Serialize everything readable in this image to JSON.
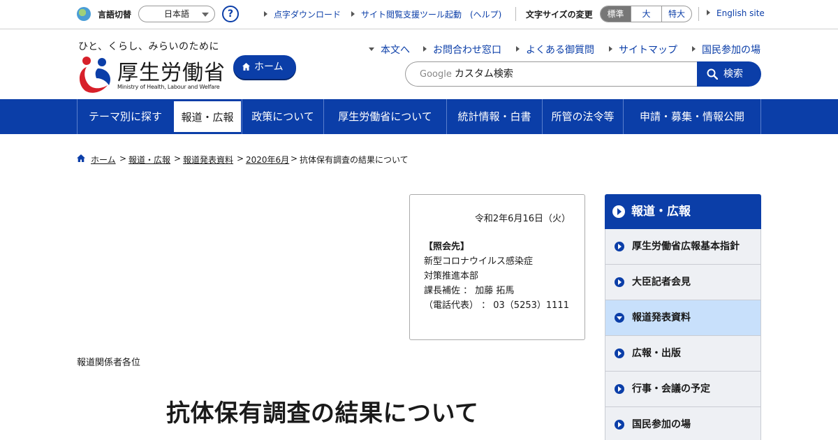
{
  "utility": {
    "language_label": "言語切替",
    "language_value": "日本語",
    "help_label": "?",
    "links": [
      "点字ダウンロード",
      "サイト閲覧支援ツール起動　(ヘルプ)"
    ],
    "font_size_label": "文字サイズの変更",
    "font_sizes": [
      "標準",
      "大",
      "特大"
    ],
    "english_link": "English site"
  },
  "header": {
    "tagline": "ひと、くらし、みらいのために",
    "logo_jp": "厚生労働省",
    "logo_en": "Ministry of Health, Labour and Welfare",
    "home_button": "ホーム",
    "links": [
      "本文へ",
      "お問合わせ窓口",
      "よくある御質問",
      "サイトマップ",
      "国民参加の場"
    ],
    "search_google": "Google",
    "search_placeholder": "カスタム検索",
    "search_button": "検索"
  },
  "gnav": [
    "テーマ別に探す",
    "報道・広報",
    "政策について",
    "厚生労働省について",
    "統計情報・白書",
    "所管の法令等",
    "申請・募集・情報公開"
  ],
  "breadcrumb": [
    "ホーム",
    "報道・広報",
    "報道発表資料",
    "2020年6月",
    "抗体保有調査の結果について"
  ],
  "breadcrumb_separator": ">",
  "contact": {
    "date": "令和2年6月16日（火）",
    "heading": "【照会先】",
    "lines": [
      "新型コロナウイルス感染症",
      "対策推進本部",
      "課長補佐 ： 加藤 拓馬",
      "（電話代表） ： 03（5253）1111"
    ]
  },
  "addressee": "報道関係者各位",
  "page_title": "抗体保有調査の結果について",
  "side_nav": {
    "heading": "報道・広報",
    "items": [
      "厚生労働省広報基本指針",
      "大臣記者会見",
      "報道発表資料",
      "広報・出版",
      "行事・会議の予定",
      "国民参加の場"
    ],
    "active_index": 2
  },
  "colors": {
    "brand_blue": "#0b3ea8",
    "active_side": "#c8e0fb",
    "logo_red": "#d7202a"
  }
}
